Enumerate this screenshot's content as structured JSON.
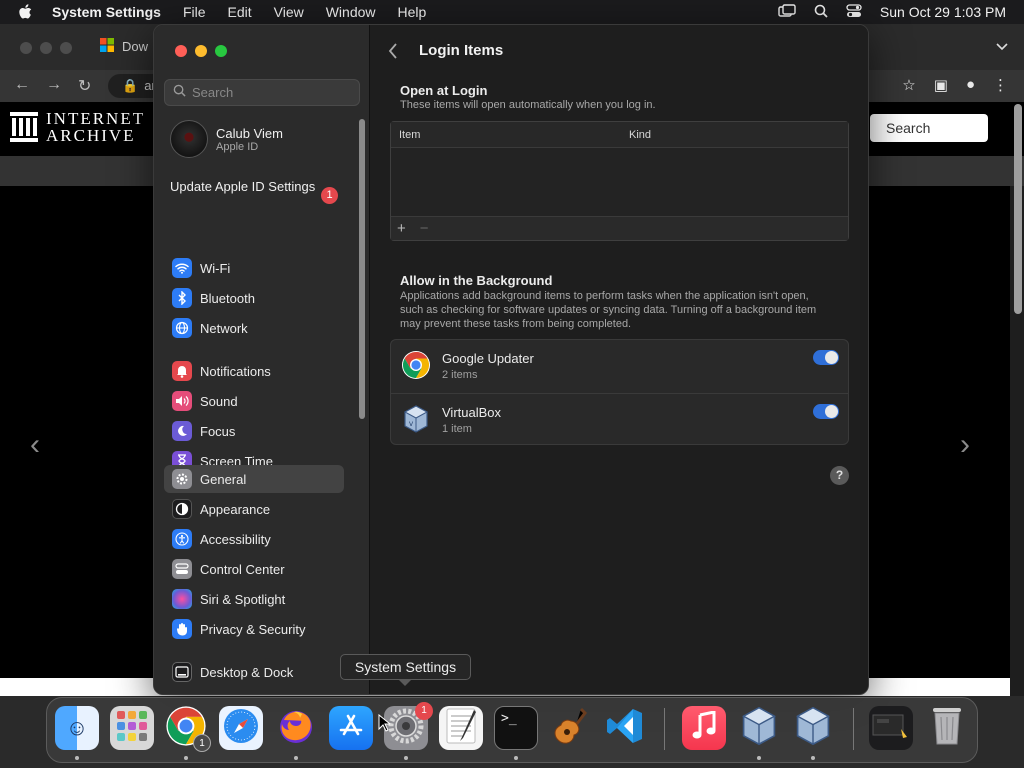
{
  "menubar": {
    "app_name": "System Settings",
    "items": [
      "File",
      "Edit",
      "View",
      "Window",
      "Help"
    ],
    "datetime": "Sun Oct 29  1:03 PM"
  },
  "browser": {
    "tab_title": "Dow",
    "address": "ar",
    "site_logo_line1": "INTERNET",
    "site_logo_line2": "ARCHIVE",
    "search_label": "Search"
  },
  "sidebar": {
    "search_placeholder": "Search",
    "profile": {
      "name": "Calub Viem",
      "sub": "Apple ID"
    },
    "update": {
      "label": "Update Apple ID Settings",
      "badge": "1"
    },
    "items": [
      {
        "label": "Wi-Fi",
        "icon": "wifi-icon",
        "color": "#2d7cf6"
      },
      {
        "label": "Bluetooth",
        "icon": "bluetooth-icon",
        "color": "#2d7cf6"
      },
      {
        "label": "Network",
        "icon": "globe-icon",
        "color": "#2d7cf6"
      },
      {
        "label": "Notifications",
        "icon": "bell-icon",
        "color": "#e5484d"
      },
      {
        "label": "Sound",
        "icon": "speaker-icon",
        "color": "#e54d7a"
      },
      {
        "label": "Focus",
        "icon": "moon-icon",
        "color": "#6b5bd6"
      },
      {
        "label": "Screen Time",
        "icon": "hourglass-icon",
        "color": "#7a4fd6"
      },
      {
        "label": "General",
        "icon": "gear-icon",
        "color": "#8e8e93"
      },
      {
        "label": "Appearance",
        "icon": "appearance-icon",
        "color": "#1c1c1e"
      },
      {
        "label": "Accessibility",
        "icon": "accessibility-icon",
        "color": "#2d7cf6"
      },
      {
        "label": "Control Center",
        "icon": "control-center-icon",
        "color": "#8e8e93"
      },
      {
        "label": "Siri & Spotlight",
        "icon": "siri-icon",
        "color": "#b04fd6"
      },
      {
        "label": "Privacy & Security",
        "icon": "hand-icon",
        "color": "#2d7cf6"
      },
      {
        "label": "Desktop & Dock",
        "icon": "dock-icon",
        "color": "#1c1c1e"
      }
    ]
  },
  "content": {
    "title": "Login Items",
    "open_at_login": {
      "title": "Open at Login",
      "description": "These items will open automatically when you log in.",
      "columns": [
        "Item",
        "Kind"
      ],
      "add": "+",
      "remove": "−"
    },
    "background": {
      "title": "Allow in the Background",
      "description": "Applications add background items to perform tasks when the application isn't open, such as checking for software updates or syncing data. Turning off a background item may prevent these tasks from being completed.",
      "items": [
        {
          "name": "Google Updater",
          "count": "2 items",
          "enabled": true,
          "icon": "chrome-icon"
        },
        {
          "name": "VirtualBox",
          "count": "1 item",
          "enabled": true,
          "icon": "virtualbox-icon"
        }
      ]
    },
    "help": "?"
  },
  "tooltip": "System Settings",
  "dock": {
    "apps": [
      "Finder",
      "Launchpad",
      "Google Chrome",
      "Safari",
      "Firefox",
      "App Store",
      "System Settings",
      "TextEdit",
      "Terminal",
      "GarageBand",
      "Visual Studio Code",
      "Music",
      "VirtualBox",
      "VirtualBox",
      "Downloads",
      "Trash"
    ],
    "chrome_badge": "1",
    "settings_badge": "1"
  }
}
